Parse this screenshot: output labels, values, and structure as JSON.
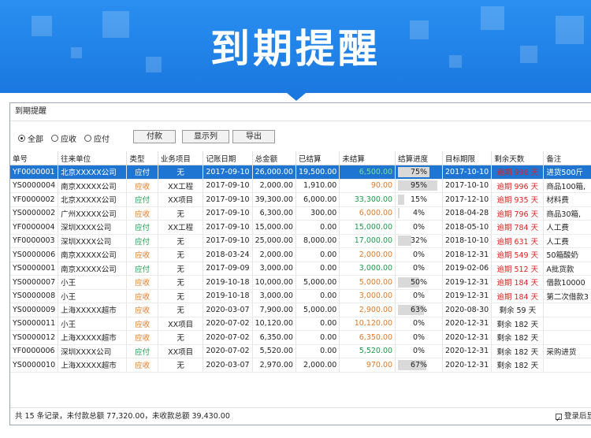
{
  "banner": {
    "title": "到期提醒"
  },
  "window": {
    "title": "到期提醒"
  },
  "filters": {
    "options": [
      {
        "label": "全部",
        "selected": true
      },
      {
        "label": "应收",
        "selected": false
      },
      {
        "label": "应付",
        "selected": false
      }
    ],
    "buttons": [
      "付款",
      "显示列",
      "导出"
    ]
  },
  "table": {
    "columns": [
      "单号",
      "往来单位",
      "类型",
      "业务项目",
      "记账日期",
      "总金额",
      "已结算",
      "未结算",
      "结算进度",
      "目标期限",
      "剩余天数",
      "备注"
    ],
    "rows": [
      {
        "no": "YF0000001",
        "unit": "北京XXXXX公司",
        "type": "应付",
        "item": "无",
        "date": "2017-09-10",
        "total": "26,000.00",
        "settled": "19,500.00",
        "unsettled": "6,500.00",
        "progress": "75%",
        "pct": 75,
        "deadline": "2017-10-10",
        "days": "逾期 996 天",
        "overdue": true,
        "note": "进货500斤"
      },
      {
        "no": "YS0000004",
        "unit": "南京XXXXX公司",
        "type": "应收",
        "item": "XX工程",
        "date": "2017-09-10",
        "total": "2,000.00",
        "settled": "1,910.00",
        "unsettled": "90.00",
        "progress": "95%",
        "pct": 95,
        "deadline": "2017-10-10",
        "days": "逾期 996 天",
        "overdue": true,
        "note": "商品100箱,"
      },
      {
        "no": "YF0000002",
        "unit": "北京XXXXX公司",
        "type": "应付",
        "item": "XX项目",
        "date": "2017-09-10",
        "total": "39,300.00",
        "settled": "6,000.00",
        "unsettled": "33,300.00",
        "progress": "15%",
        "pct": 15,
        "deadline": "2017-12-10",
        "days": "逾期 935 天",
        "overdue": true,
        "note": "材料费"
      },
      {
        "no": "YS0000002",
        "unit": "广州XXXXX公司",
        "type": "应收",
        "item": "无",
        "date": "2017-09-10",
        "total": "6,300.00",
        "settled": "300.00",
        "unsettled": "6,000.00",
        "progress": "4%",
        "pct": 4,
        "deadline": "2018-04-28",
        "days": "逾期 796 天",
        "overdue": true,
        "note": "商品30箱,"
      },
      {
        "no": "YF0000004",
        "unit": "深圳XXXX公司",
        "type": "应付",
        "item": "XX工程",
        "date": "2017-09-10",
        "total": "15,000.00",
        "settled": "0.00",
        "unsettled": "15,000.00",
        "progress": "0%",
        "pct": 0,
        "deadline": "2018-05-10",
        "days": "逾期 784 天",
        "overdue": true,
        "note": "人工费"
      },
      {
        "no": "YF0000003",
        "unit": "深圳XXXX公司",
        "type": "应付",
        "item": "无",
        "date": "2017-09-10",
        "total": "25,000.00",
        "settled": "8,000.00",
        "unsettled": "17,000.00",
        "progress": "32%",
        "pct": 32,
        "deadline": "2018-10-10",
        "days": "逾期 631 天",
        "overdue": true,
        "note": "人工费"
      },
      {
        "no": "YS0000006",
        "unit": "南京XXXXX公司",
        "type": "应收",
        "item": "无",
        "date": "2018-03-24",
        "total": "2,000.00",
        "settled": "0.00",
        "unsettled": "2,000.00",
        "progress": "0%",
        "pct": 0,
        "deadline": "2018-12-31",
        "days": "逾期 549 天",
        "overdue": true,
        "note": "50箱酸奶"
      },
      {
        "no": "YS0000001",
        "unit": "南京XXXXX公司",
        "type": "应付",
        "item": "无",
        "date": "2017-09-09",
        "total": "3,000.00",
        "settled": "0.00",
        "unsettled": "3,000.00",
        "progress": "0%",
        "pct": 0,
        "deadline": "2019-02-06",
        "days": "逾期 512 天",
        "overdue": true,
        "note": "A批货款"
      },
      {
        "no": "YS0000007",
        "unit": "小王",
        "type": "应收",
        "item": "无",
        "date": "2019-10-18",
        "total": "10,000.00",
        "settled": "5,000.00",
        "unsettled": "5,000.00",
        "progress": "50%",
        "pct": 50,
        "deadline": "2019-12-31",
        "days": "逾期 184 天",
        "overdue": true,
        "note": "借款10000"
      },
      {
        "no": "YS0000008",
        "unit": "小王",
        "type": "应收",
        "item": "无",
        "date": "2019-10-18",
        "total": "3,000.00",
        "settled": "0.00",
        "unsettled": "3,000.00",
        "progress": "0%",
        "pct": 0,
        "deadline": "2019-12-31",
        "days": "逾期 184 天",
        "overdue": true,
        "note": "第二次借款3"
      },
      {
        "no": "YS0000009",
        "unit": "上海XXXXX超市",
        "type": "应收",
        "item": "无",
        "date": "2020-03-07",
        "total": "7,900.00",
        "settled": "5,000.00",
        "unsettled": "2,900.00",
        "progress": "63%",
        "pct": 63,
        "deadline": "2020-08-30",
        "days": "剩余 59 天",
        "overdue": false,
        "note": ""
      },
      {
        "no": "YS0000011",
        "unit": "小王",
        "type": "应收",
        "item": "XX项目",
        "date": "2020-07-02",
        "total": "10,120.00",
        "settled": "0.00",
        "unsettled": "10,120.00",
        "progress": "0%",
        "pct": 0,
        "deadline": "2020-12-31",
        "days": "剩余 182 天",
        "overdue": false,
        "note": ""
      },
      {
        "no": "YS0000012",
        "unit": "上海XXXXX超市",
        "type": "应收",
        "item": "无",
        "date": "2020-07-02",
        "total": "6,350.00",
        "settled": "0.00",
        "unsettled": "6,350.00",
        "progress": "0%",
        "pct": 0,
        "deadline": "2020-12-31",
        "days": "剩余 182 天",
        "overdue": false,
        "note": ""
      },
      {
        "no": "YF0000006",
        "unit": "深圳XXXX公司",
        "type": "应付",
        "item": "XX项目",
        "date": "2020-07-02",
        "total": "5,520.00",
        "settled": "0.00",
        "unsettled": "5,520.00",
        "progress": "0%",
        "pct": 0,
        "deadline": "2020-12-31",
        "days": "剩余 182 天",
        "overdue": false,
        "note": "采购进货"
      },
      {
        "no": "YS0000010",
        "unit": "上海XXXXX超市",
        "type": "应收",
        "item": "无",
        "date": "2020-03-07",
        "total": "2,970.00",
        "settled": "2,000.00",
        "unsettled": "970.00",
        "progress": "67%",
        "pct": 67,
        "deadline": "2020-12-31",
        "days": "剩余 182 天",
        "overdue": false,
        "note": ""
      }
    ]
  },
  "status": {
    "summary": "共 15 条记录，未付款总额 77,320.00，未收款总额 39,430.00",
    "login_label": "登录后显"
  },
  "colors": {
    "banner": "#1a78e0",
    "selected_row": "#1e76d2",
    "receivable": "#e07a2a",
    "payable": "#1f9a4a",
    "overdue": "#e02020"
  }
}
